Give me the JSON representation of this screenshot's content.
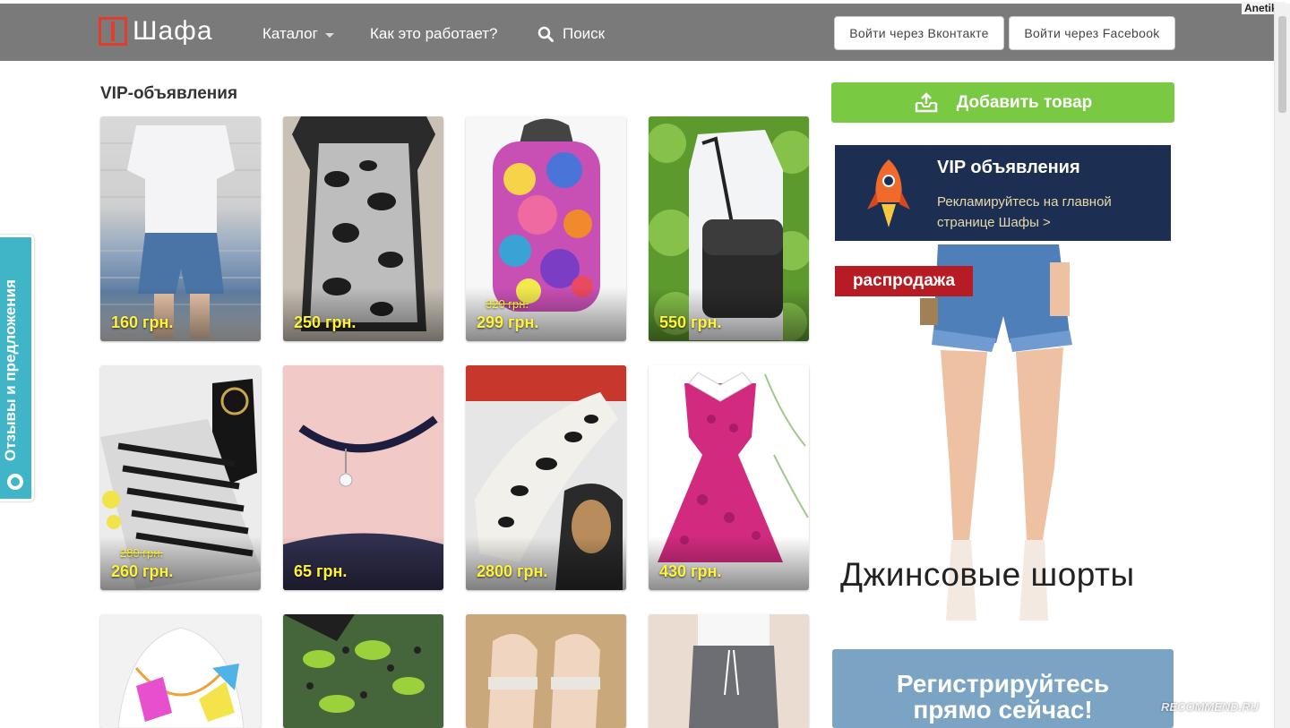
{
  "header": {
    "logo_text": "Шафа",
    "nav": {
      "catalog": "Каталог",
      "how_it_works": "Как это работает?",
      "search": "Поиск"
    },
    "login_vk": "Войти через Вконтакте",
    "login_fb": "Войти через Facebook"
  },
  "watermark_user": "Anetiks",
  "section_title": "VIP-объявления",
  "cards": [
    {
      "price": "160 грн.",
      "old_price": ""
    },
    {
      "price": "250 грн.",
      "old_price": ""
    },
    {
      "price": "299 грн.",
      "old_price": "320 грн."
    },
    {
      "price": "550 грн.",
      "old_price": ""
    },
    {
      "price": "260 грн.",
      "old_price": "280 грн."
    },
    {
      "price": "65 грн.",
      "old_price": ""
    },
    {
      "price": "2800 грн.",
      "old_price": ""
    },
    {
      "price": "430 грн.",
      "old_price": ""
    }
  ],
  "sidebar": {
    "add_button": "Добавить товар",
    "vip_banner": {
      "title": "VIP объявления",
      "subtitle": "Рекламируйтесь на главной странице Шафы >"
    },
    "shorts_ad": {
      "sale_tag": "распродажа",
      "title": "Джинсовые шорты"
    },
    "register": {
      "line1": "Регистрируйтесь",
      "line2": "прямо сейчас!"
    }
  },
  "feedback_tab": "Отзывы и предложения",
  "recommend_watermark": "RECOMMEND.RU",
  "colors": {
    "header_bg": "#7a7a7a",
    "logo_red": "#e33b2c",
    "add_green": "#7ac943",
    "vip_navy": "#1c2f52",
    "sale_red": "#b71c25",
    "register_blue": "#7aa3c4",
    "feedback_teal": "#3fb5c7",
    "price_yellow": "#fff23a"
  }
}
